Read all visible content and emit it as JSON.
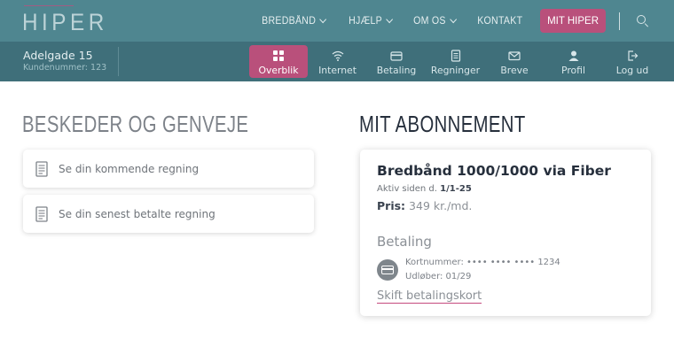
{
  "brand": {
    "logo": "HIPER"
  },
  "topnav": {
    "items": [
      {
        "label": "BREDBÅND",
        "dropdown": true
      },
      {
        "label": "HJÆLP",
        "dropdown": true
      },
      {
        "label": "OM OS",
        "dropdown": true
      },
      {
        "label": "KONTAKT",
        "dropdown": false
      }
    ],
    "cta": "MIT HIPER",
    "search_icon": "search-icon"
  },
  "account": {
    "address": "Adelgade 15",
    "customer_number": "Kundenummer: 123"
  },
  "tabs": [
    {
      "label": "Overblik",
      "icon": "grid-icon",
      "active": true
    },
    {
      "label": "Internet",
      "icon": "wifi-icon",
      "active": false
    },
    {
      "label": "Betaling",
      "icon": "credit-card-icon",
      "active": false
    },
    {
      "label": "Regninger",
      "icon": "document-icon",
      "active": false
    },
    {
      "label": "Breve",
      "icon": "envelope-icon",
      "active": false
    },
    {
      "label": "Profil",
      "icon": "user-icon",
      "active": false
    },
    {
      "label": "Log ud",
      "icon": "logout-icon",
      "active": false
    }
  ],
  "messages": {
    "heading": "BESKEDER OG GENVEJE",
    "items": [
      {
        "label": "Se din kommende regning",
        "icon": "document-icon"
      },
      {
        "label": "Se din senest betalte regning",
        "icon": "document-icon"
      }
    ]
  },
  "subscription": {
    "heading": "MIT ABONNEMENT",
    "plan": "Bredbånd 1000/1000 via Fiber",
    "since_label": "Aktiv siden d.",
    "since_date": "1/1-25",
    "price_label": "Pris:",
    "price_value": "349 kr./md.",
    "payment_heading": "Betaling",
    "card_number": "Kortnummer: •••• •••• •••• 1234",
    "expiry": "Udløber: 01/29",
    "change_card": "Skift betalingskort"
  },
  "colors": {
    "topbar": "#4f8690",
    "subbar": "#3f6f7a",
    "accent": "#b9507b"
  }
}
